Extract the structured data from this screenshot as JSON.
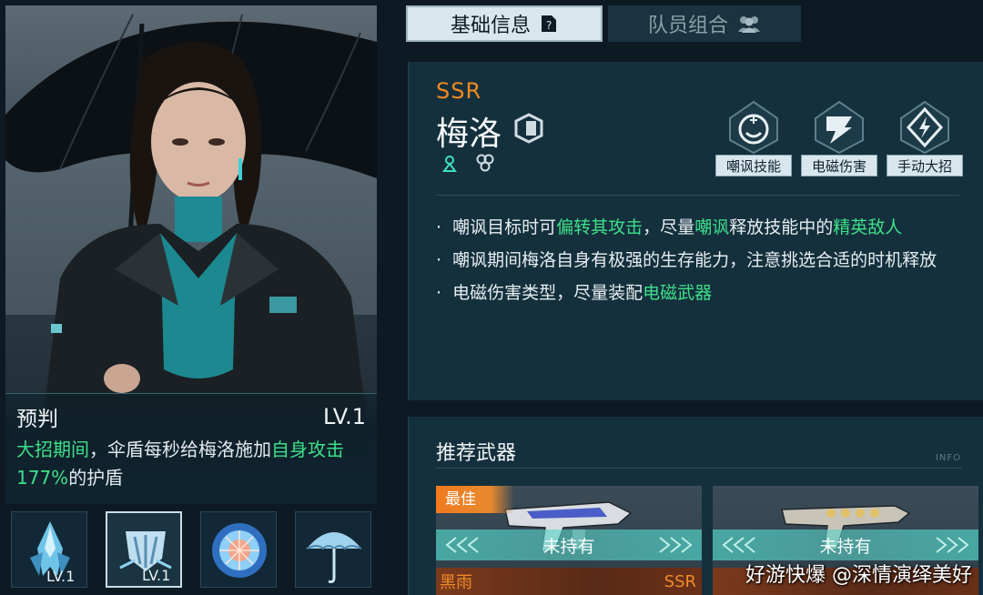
{
  "tabs": {
    "basic_info": "基础信息",
    "team_combo": "队员组合"
  },
  "character": {
    "rarity": "SSR",
    "name": "梅洛",
    "tags": [
      "嘲讽技能",
      "电磁伤害",
      "手动大招"
    ]
  },
  "tips": {
    "tip1": {
      "p1": "嘲讽目标时可",
      "h1": "偏转其攻击",
      "p2": "，尽量",
      "h2": "嘲讽",
      "p3": "释放技能中的",
      "h3": "精英敌人"
    },
    "tip2": "嘲讽期间梅洛自身有极强的生存能力，注意挑选合适的时机释放",
    "tip3": {
      "p1": "电磁伤害类型，尽量装配",
      "h1": "电磁武器"
    },
    "bullet": "·"
  },
  "skill": {
    "name": "预判",
    "level": "LV.1",
    "desc": {
      "h1": "大招期间",
      "p1": "，伞盾每秒给梅洛施加",
      "h2": "自身攻击177%",
      "p2": "的护盾"
    }
  },
  "skill_slots": [
    {
      "level": "LV.1",
      "icon": "rocket-icon"
    },
    {
      "level": "LV.1",
      "icon": "shield-burst-icon"
    },
    {
      "level": "",
      "icon": "orb-icon"
    },
    {
      "level": "",
      "icon": "umbrella-icon"
    }
  ],
  "weapons": {
    "title": "推荐武器",
    "info_label": "INFO",
    "cards": [
      {
        "badge": "最佳",
        "status": "未持有",
        "name": "黑雨",
        "rarity": "SSR"
      },
      {
        "badge": "",
        "status": "未持有",
        "name": "",
        "rarity": ""
      }
    ]
  },
  "watermark": "好游快爆 @深情演绎美好",
  "colors": {
    "highlight": "#3ee08a",
    "rarity": "#f08a22",
    "panel": "#15303d"
  }
}
